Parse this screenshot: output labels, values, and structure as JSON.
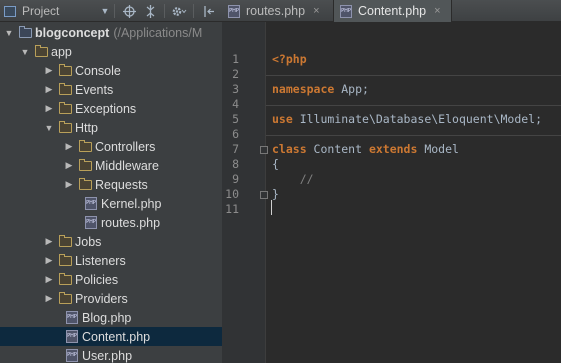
{
  "toolbar": {
    "project_label": "Project",
    "dropdown_glyph": "▼",
    "icons": [
      "project-view-icon",
      "locate-target-icon",
      "collapse-all-icon",
      "gear-icon",
      "hide-panel-icon"
    ]
  },
  "tree": {
    "root_label": "blogconcept",
    "root_path": "(/Applications/M",
    "items": [
      {
        "label": "app"
      },
      {
        "label": "Console"
      },
      {
        "label": "Events"
      },
      {
        "label": "Exceptions"
      },
      {
        "label": "Http"
      },
      {
        "label": "Controllers"
      },
      {
        "label": "Middleware"
      },
      {
        "label": "Requests"
      },
      {
        "label": "Kernel.php"
      },
      {
        "label": "routes.php"
      },
      {
        "label": "Jobs"
      },
      {
        "label": "Listeners"
      },
      {
        "label": "Policies"
      },
      {
        "label": "Providers"
      },
      {
        "label": "Blog.php"
      },
      {
        "label": "Content.php"
      },
      {
        "label": "User.php"
      }
    ],
    "php_icon_text": "PHP"
  },
  "tabs": [
    {
      "label": "routes.php",
      "close": "×"
    },
    {
      "label": "Content.php",
      "close": "×"
    }
  ],
  "editor": {
    "line_numbers": [
      "1",
      "2",
      "3",
      "4",
      "5",
      "6",
      "7",
      "8",
      "9",
      "10",
      "11"
    ],
    "open_tag": "<?php",
    "namespace_kw": "namespace",
    "namespace_name": " App;",
    "use_kw": "use",
    "use_path": " Illuminate\\Database\\Eloquent\\Model;",
    "class_kw": "class",
    "class_name": " Content ",
    "extends_kw": "extends",
    "parent_name": " Model",
    "open_brace": "{",
    "comment": "    //",
    "close_brace": "}"
  },
  "colors": {
    "keyword": "#cc7832",
    "text": "#a9b7c6",
    "selection": "#0d293e"
  }
}
